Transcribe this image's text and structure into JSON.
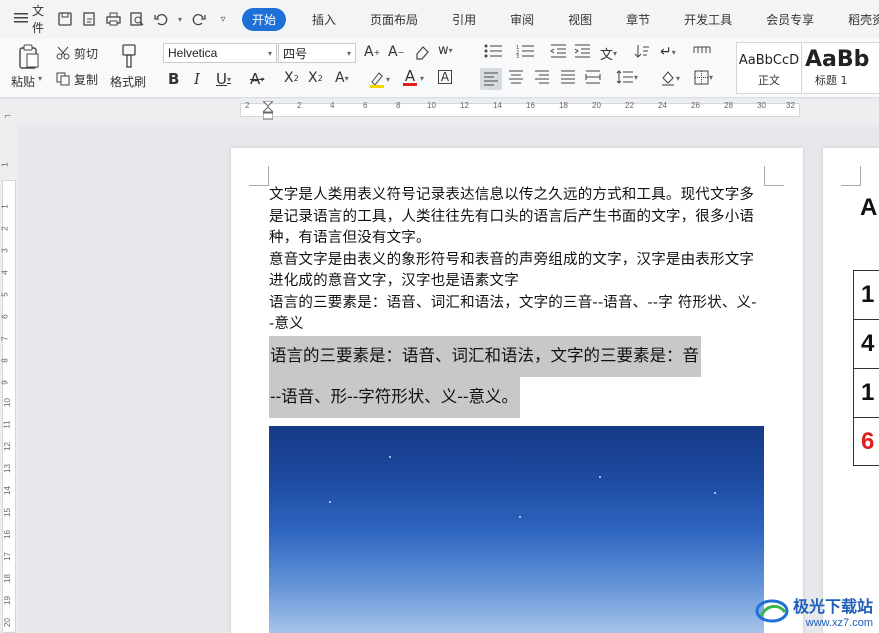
{
  "menubar": {
    "file_label": "文件",
    "tabs": [
      "开始",
      "插入",
      "页面布局",
      "引用",
      "审阅",
      "视图",
      "章节",
      "开发工具",
      "会员专享",
      "稻壳资源"
    ],
    "active_tab": "开始"
  },
  "ribbon": {
    "paste_label": "粘贴",
    "cut_label": "剪切",
    "copy_label": "复制",
    "format_painter_label": "格式刷",
    "font_name": "Helvetica",
    "font_size": "四号",
    "styles": [
      {
        "preview": "AaBbCcD",
        "name": "正文"
      },
      {
        "preview": "AaBb",
        "name": "标题 1"
      }
    ]
  },
  "ruler": {
    "h_ticks": [
      "2",
      "2",
      "4",
      "6",
      "8",
      "10",
      "12",
      "14",
      "16",
      "18",
      "20",
      "22",
      "24",
      "26",
      "28",
      "30",
      "32"
    ],
    "v_ticks": [
      "1",
      "1",
      "2",
      "3",
      "4",
      "5",
      "6",
      "7",
      "8",
      "9",
      "10",
      "11",
      "12",
      "13",
      "14",
      "15",
      "16",
      "17",
      "18",
      "19",
      "20"
    ]
  },
  "document": {
    "paragraphs": [
      "文字是人类用表义符号记录表达信息以传之久远的方式和工具。现代文字多是记录语言的工具，人类往往先有口头的语言后产生书面的文字，很多小语种，有语言但没有文字。",
      "意音文字是由表义的象形符号和表音的声旁组成的文字，汉字是由表形文字进化成的意音文字，汉字也是语素文字",
      "语言的三要素是：语音、词汇和语法，文字的三音--语音、--字  符形状、义--意义"
    ],
    "highlighted_lines": [
      "语言的三要素是：语音、词汇和语法，文字的三要素是：音",
      "--语音、形--字符形状、义--意义。"
    ],
    "page2": {
      "heading": "A",
      "cells": [
        "1",
        "4",
        "1",
        "6"
      ],
      "accent_color": "#e02020"
    }
  },
  "watermark": {
    "brand": "极光下载站",
    "url": "www.xz7.com"
  }
}
